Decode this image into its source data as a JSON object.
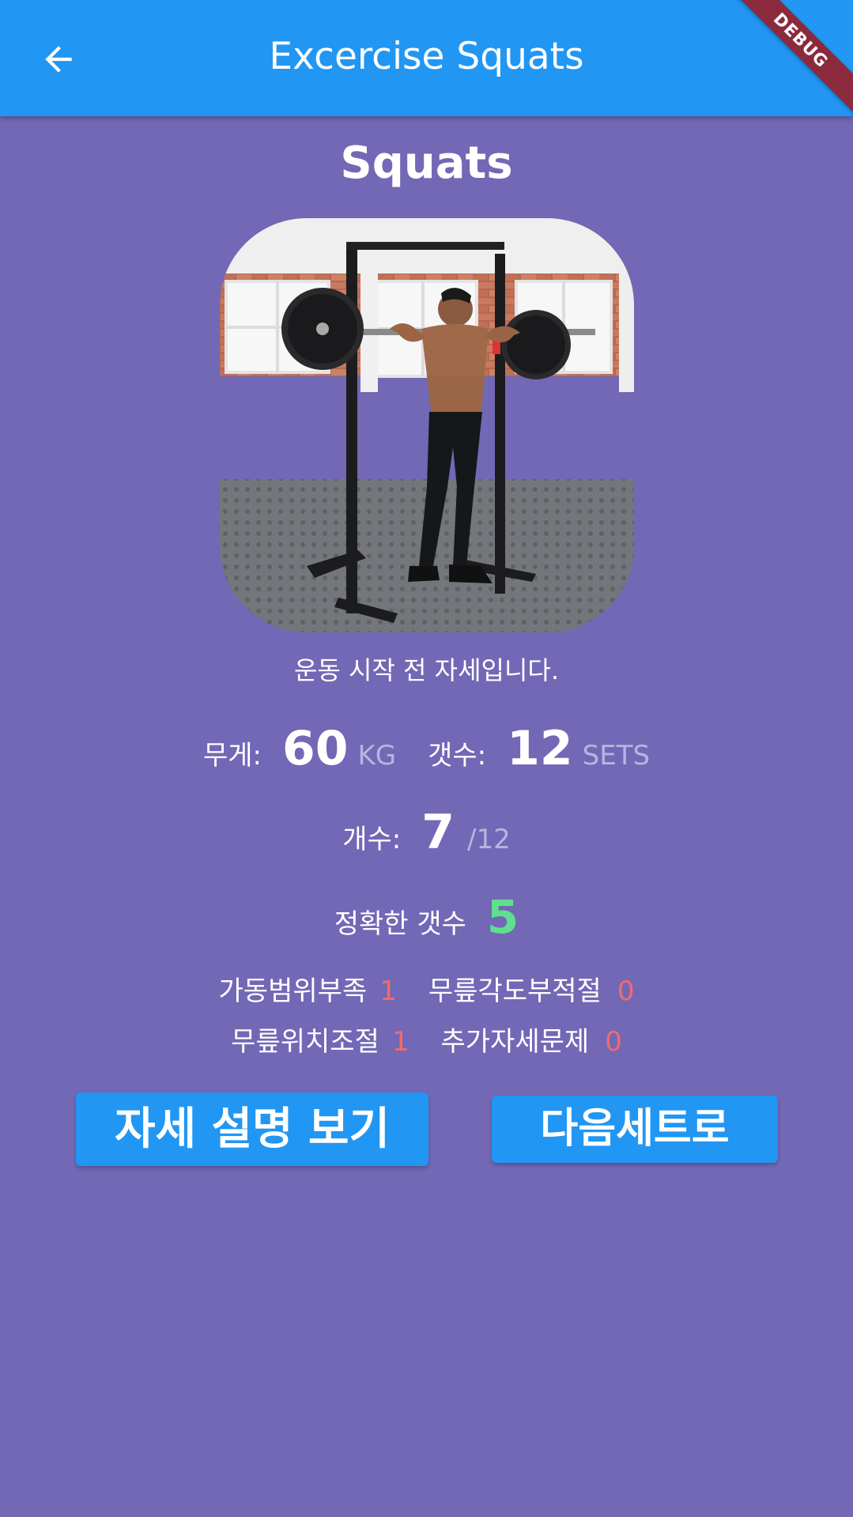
{
  "appbar": {
    "title": "Excercise Squats",
    "back_icon": "arrow-left-icon",
    "debug_label": "DEBUG"
  },
  "exercise": {
    "name": "Squats",
    "image_alt": "man holding barbell in squat rack",
    "caption": "운동 시작 전 자세입니다."
  },
  "stats": {
    "weight_label": "무게:",
    "weight_value": "60",
    "weight_unit": "KG",
    "sets_label": "갯수:",
    "sets_value": "12",
    "sets_unit": "SETS",
    "count_label": "개수:",
    "count_value": "7",
    "count_total": "/12",
    "correct_label": "정확한 갯수",
    "correct_value": "5"
  },
  "errors": {
    "range_label": "가동범위부족",
    "range_value": "1",
    "knee_angle_label": "무릎각도부적절",
    "knee_angle_value": "0",
    "knee_position_label": "무릎위치조절",
    "knee_position_value": "1",
    "extra_label": "추가자세문제",
    "extra_value": "0"
  },
  "buttons": {
    "explain_label": "자세 설명 보기",
    "next_label": "다음세트로"
  },
  "colors": {
    "appbar": "#2196f3",
    "background": "#7268b5",
    "accent_green": "#5ee08f",
    "error_red": "#f26b6b",
    "debug": "#8b2a3c"
  }
}
